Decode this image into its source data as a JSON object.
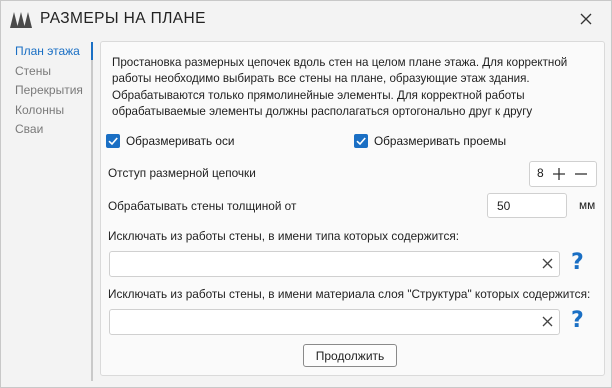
{
  "window": {
    "title": "РАЗМЕРЫ НА ПЛАНЕ",
    "brand_color": "#4a4a4a",
    "accent": "#1a6fc4"
  },
  "sidebar": {
    "items": [
      {
        "label": "План этажа",
        "active": true
      },
      {
        "label": "Стены",
        "active": false
      },
      {
        "label": "Перекрытия",
        "active": false
      },
      {
        "label": "Колонны",
        "active": false
      },
      {
        "label": "Сваи",
        "active": false
      }
    ]
  },
  "main": {
    "description_lines": [
      "Простановка размерных цепочек вдоль стен на целом плане этажа. Для корректной",
      "работы необходимо выбирать все стены на плане, образующие этаж здания.",
      "Обрабатываются только прямолинейные элементы. Для корректной работы",
      "обрабатываемые элементы должны располагаться ортогонально друг к другу"
    ],
    "check_axes": {
      "label": "Образмеривать оси",
      "checked": true
    },
    "check_openings": {
      "label": "Образмеривать проемы",
      "checked": true
    },
    "offset": {
      "label": "Отступ размерной цепочки",
      "value": "8"
    },
    "thickness": {
      "label": "Обрабатывать стены толщиной от",
      "value": "50",
      "unit": "мм"
    },
    "exclude_type": {
      "label": "Исключать из работы стены, в имени типа которых содержится:",
      "value": ""
    },
    "exclude_material": {
      "label": "Исключать из работы стены, в имени материала слоя \"Структура\" которых содержится:",
      "value": ""
    },
    "help_glyph": "?",
    "continue_label": "Продолжить"
  },
  "icons": [
    "app-logo-icon",
    "close-icon",
    "check-icon",
    "plus-icon",
    "minus-icon",
    "clear-icon",
    "help-icon"
  ]
}
